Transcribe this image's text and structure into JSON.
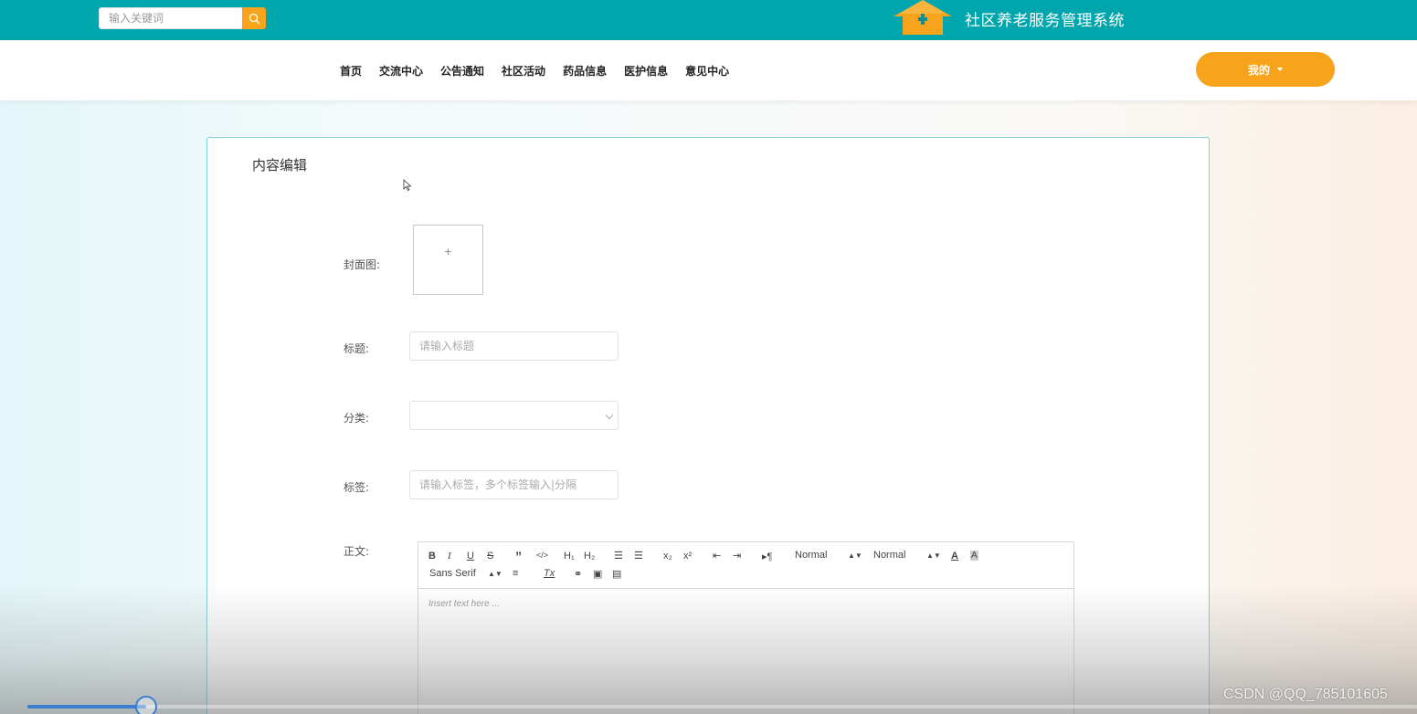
{
  "header": {
    "search_placeholder": "输入关键词",
    "site_title": "社区养老服务管理系统",
    "brand_color": "#00a6ad",
    "accent_color": "#f7a31c"
  },
  "nav": {
    "items": [
      {
        "label": "首页"
      },
      {
        "label": "交流中心"
      },
      {
        "label": "公告通知"
      },
      {
        "label": "社区活动"
      },
      {
        "label": "药品信息"
      },
      {
        "label": "医护信息"
      },
      {
        "label": "意见中心"
      }
    ],
    "mine_label": "我的"
  },
  "form": {
    "title": "内容编辑",
    "cover_label": "封面图:",
    "cover_plus": "+",
    "title_label": "标题:",
    "title_placeholder": "请输入标题",
    "category_label": "分类:",
    "category_value": "",
    "tags_label": "标签:",
    "tags_placeholder": "请输入标签，多个标签输入|分隔",
    "body_label": "正文:"
  },
  "editor": {
    "header_select": "Normal",
    "size_select": "Normal",
    "font_select": "Sans Serif",
    "placeholder": "Insert text here ..."
  },
  "video": {
    "progress": 0.08
  },
  "watermark": "CSDN @QQ_785101605"
}
